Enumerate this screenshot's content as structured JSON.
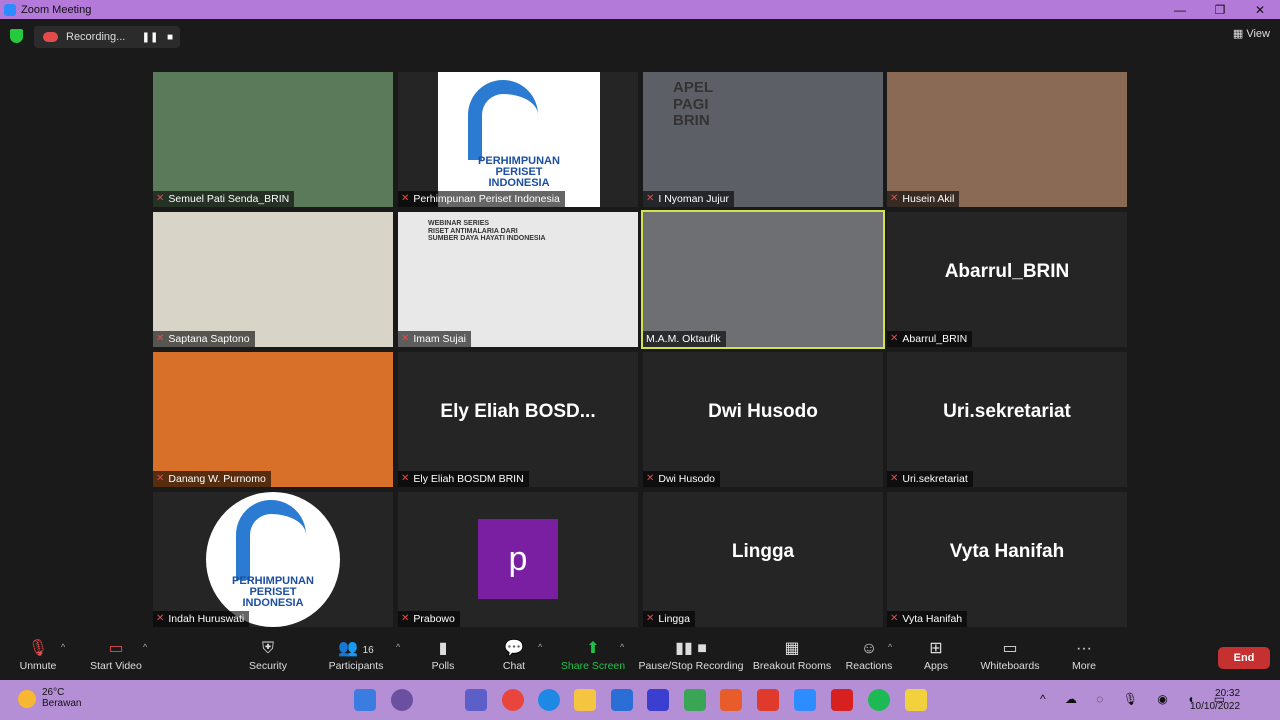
{
  "window": {
    "title": "Zoom Meeting",
    "minimize": "—",
    "maximize": "❐",
    "close": "✕"
  },
  "topbar": {
    "recording_label": "Recording...",
    "pause": "❚❚",
    "stop": "■",
    "view_label": "View",
    "view_icon": "grid-icon"
  },
  "participants": [
    {
      "name": "Semuel Pati Senda_BRIN",
      "kind": "photo",
      "bg": "#5a7a5a"
    },
    {
      "name": "Perhimpunan Periset Indonesia",
      "kind": "logo",
      "logo_lines": [
        "PERHIMPUNAN",
        "PERISET",
        "INDONESIA"
      ]
    },
    {
      "name": "I Nyoman Jujur",
      "kind": "photo",
      "bg": "#5d5f66",
      "overlay": [
        "APEL",
        "PAGI",
        "BRIN"
      ]
    },
    {
      "name": "Husein Akil",
      "kind": "photo",
      "bg": "#8a6a55"
    },
    {
      "name": "Saptana Saptono",
      "kind": "photo",
      "bg": "#d9d4c8"
    },
    {
      "name": "Imam Sujai",
      "kind": "photo",
      "bg": "#e8e8e8",
      "overlay": [
        "WEBINAR SERIES",
        "RISET ANTIMALARIA DARI",
        "SUMBER DAYA HAYATI INDONESIA"
      ]
    },
    {
      "name": "M.A.M. Oktaufik",
      "kind": "photo",
      "bg": "#6d6f72",
      "active": true
    },
    {
      "name": "Abarrul_BRIN",
      "kind": "name",
      "display": "Abarrul_BRIN"
    },
    {
      "name": "Danang W. Purnomo",
      "kind": "photo",
      "bg": "#d9702a"
    },
    {
      "name": "Ely Eliah BOSDM BRIN",
      "kind": "name",
      "display": "Ely Eliah BOSD..."
    },
    {
      "name": "Dwi Husodo",
      "kind": "name",
      "display": "Dwi Husodo"
    },
    {
      "name": "Uri.sekretariat",
      "kind": "name",
      "display": "Uri.sekretariat"
    },
    {
      "name": "Indah Huruswati",
      "kind": "logo",
      "logo_lines": [
        "PERHIMPUNAN",
        "PERISET",
        "INDONESIA"
      ]
    },
    {
      "name": "Prabowo",
      "kind": "letter",
      "letter": "p"
    },
    {
      "name": "Lingga",
      "kind": "name",
      "display": "Lingga"
    },
    {
      "name": "Vyta Hanifah",
      "kind": "name",
      "display": "Vyta Hanifah"
    }
  ],
  "toolbar": {
    "unmute": "Unmute",
    "start_video": "Start Video",
    "security": "Security",
    "participants": "Participants",
    "participants_count": "16",
    "polls": "Polls",
    "chat": "Chat",
    "share_screen": "Share Screen",
    "recording": "Pause/Stop Recording",
    "breakout": "Breakout Rooms",
    "reactions": "Reactions",
    "apps": "Apps",
    "whiteboards": "Whiteboards",
    "more": "More",
    "end": "End"
  },
  "taskbar": {
    "temp": "26°C",
    "weather": "Berawan",
    "time": "20:32",
    "date": "10/10/2022"
  },
  "colors": {
    "accent_green": "#1ec24a",
    "end_red": "#c53030",
    "active_outline": "#d5e34a",
    "title_purple": "#b47ad9"
  }
}
